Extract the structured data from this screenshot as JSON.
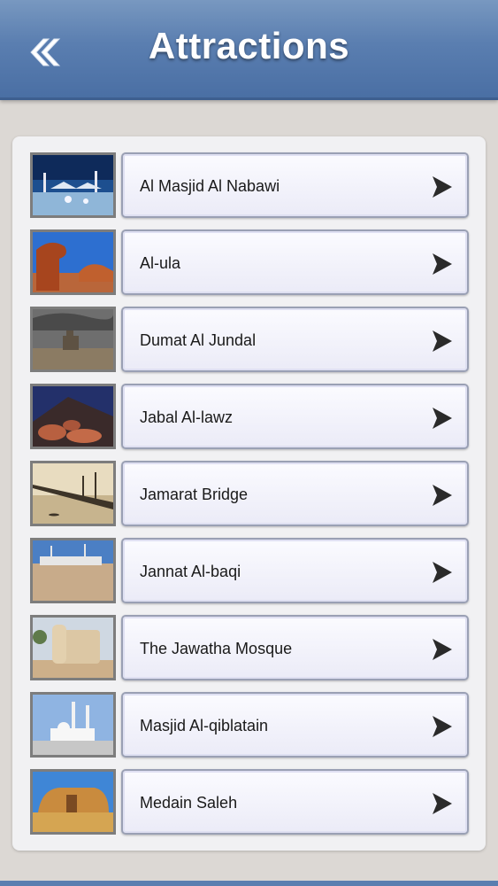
{
  "header": {
    "title": "Attractions",
    "back_icon": "double-chevron-left-icon"
  },
  "items": [
    {
      "label": "Al Masjid Al Nabawi"
    },
    {
      "label": "Al-ula"
    },
    {
      "label": "Dumat Al Jundal"
    },
    {
      "label": "Jabal Al-lawz"
    },
    {
      "label": "Jamarat Bridge"
    },
    {
      "label": "Jannat Al-baqi"
    },
    {
      "label": "The Jawatha Mosque"
    },
    {
      "label": "Masjid Al-qiblatain"
    },
    {
      "label": "Medain Saleh"
    }
  ],
  "colors": {
    "header": "#5a7eb0",
    "background": "#dcd8d4",
    "panel": "#f1f1f3"
  }
}
